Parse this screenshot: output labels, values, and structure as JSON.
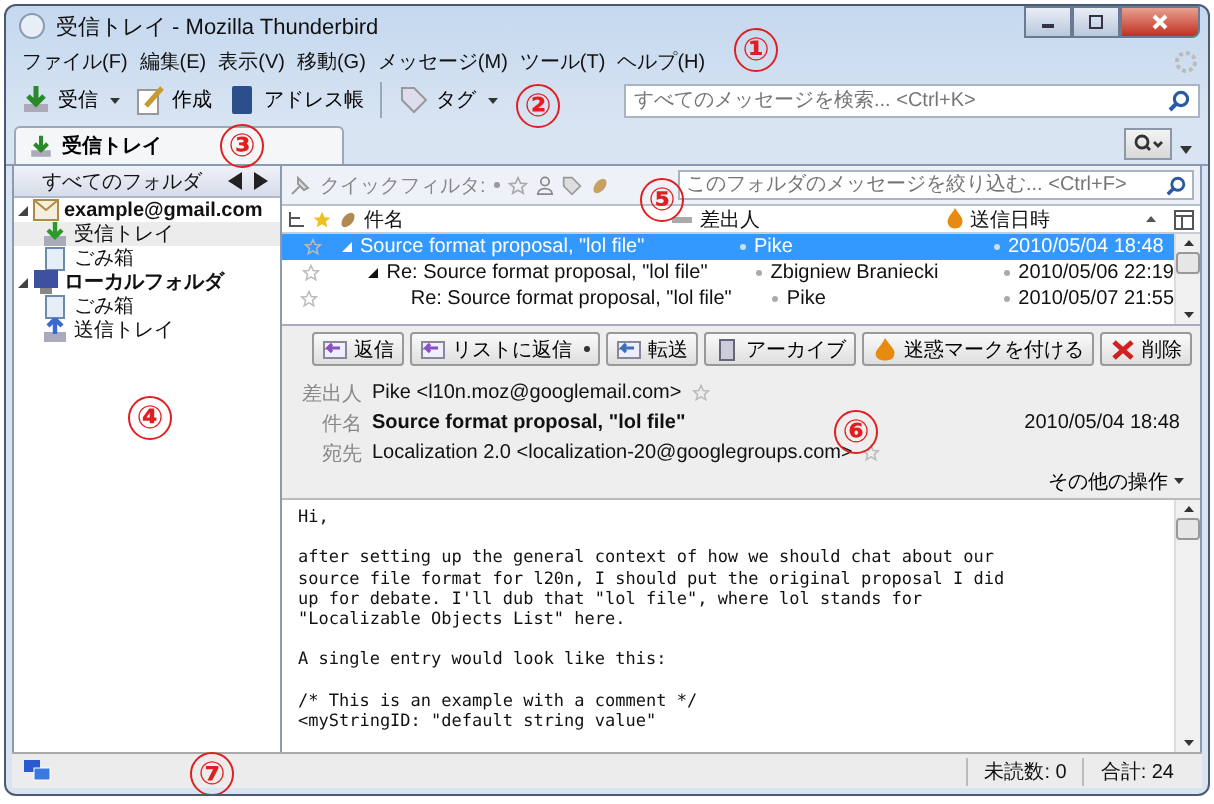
{
  "window": {
    "title": "受信トレイ - Mozilla Thunderbird"
  },
  "menu": [
    "ファイル(F)",
    "編集(E)",
    "表示(V)",
    "移動(G)",
    "メッセージ(M)",
    "ツール(T)",
    "ヘルプ(H)"
  ],
  "toolbar": {
    "buttons": [
      {
        "label": "受信",
        "kind": "get",
        "dropdown": true
      },
      {
        "label": "作成",
        "kind": "write",
        "dropdown": false
      },
      {
        "label": "アドレス帳",
        "kind": "book",
        "dropdown": false
      },
      {
        "label": "タグ",
        "kind": "tag",
        "dropdown": true
      }
    ],
    "search": {
      "placeholder": "すべてのメッセージを検索... <Ctrl+K>"
    }
  },
  "tabs": [
    {
      "label": "受信トレイ",
      "selected": true
    }
  ],
  "folder_pane": {
    "header": "すべてのフォルダ",
    "accounts": [
      {
        "name": "example@gmail.com",
        "kind": "mail",
        "expanded": true,
        "children": [
          {
            "name": "受信トレイ",
            "kind": "inbox",
            "selected": true
          },
          {
            "name": "ごみ箱",
            "kind": "trash",
            "selected": false
          }
        ]
      },
      {
        "name": "ローカルフォルダ",
        "kind": "local",
        "expanded": true,
        "children": [
          {
            "name": "ごみ箱",
            "kind": "trash",
            "selected": false
          },
          {
            "name": "送信トレイ",
            "kind": "outbox",
            "selected": false
          }
        ]
      }
    ]
  },
  "quick_filter": {
    "label": "クイックフィルタ:",
    "placeholder": "このフォルダのメッセージを絞り込む... <Ctrl+F>"
  },
  "thread_list": {
    "columns": [
      "件名",
      "差出人",
      "送信日時"
    ],
    "rows": [
      {
        "subject": "Source format proposal, \"lol file\"",
        "sender": "Pike",
        "date": "2010/05/04 18:48",
        "selected": true,
        "starred": false,
        "children": [
          {
            "subject": "Re: Source format proposal, \"lol file\"",
            "sender": "Zbigniew Braniecki",
            "date": "2010/05/06 22:19",
            "selected": false,
            "starred": false,
            "children": [
              {
                "subject": "Re: Source format proposal, \"lol file\"",
                "sender": "Pike",
                "date": "2010/05/07 21:55",
                "selected": false,
                "starred": false
              }
            ]
          }
        ]
      }
    ]
  },
  "message": {
    "actions": [
      {
        "label": "返信",
        "kind": "reply",
        "dropdown": false
      },
      {
        "label": "リストに返信",
        "kind": "reply-list",
        "dropdown": true
      },
      {
        "label": "転送",
        "kind": "forward",
        "dropdown": false
      },
      {
        "label": "アーカイブ",
        "kind": "archive",
        "dropdown": false
      },
      {
        "label": "迷惑マークを付ける",
        "kind": "junk",
        "dropdown": false
      },
      {
        "label": "削除",
        "kind": "delete",
        "dropdown": false
      }
    ],
    "from_label": "差出人",
    "from": "Pike <l10n.moz@googlemail.com>",
    "subject_label": "件名",
    "subject": "Source format proposal, \"lol file\"",
    "date": "2010/05/04 18:48",
    "to_label": "宛先",
    "to": "Localization 2.0 <localization-20@googlegroups.com>",
    "other_actions": "その他の操作",
    "body": [
      [
        "Hi,"
      ],
      [
        "after setting up the general context of how we should chat about our",
        "source file format for l20n, I should put the original proposal I did",
        "up for debate. I'll dub that \"lol file\", where lol stands for",
        "\"Localizable Objects List\" here."
      ],
      [
        "A single entry would look like this:"
      ],
      [
        "/* This is an example with a comment */",
        "<myStringID: \"default string value\""
      ]
    ]
  },
  "status_bar": {
    "unread": "未読数: 0",
    "total": "合計: 24"
  },
  "callouts": [
    "①",
    "②",
    "③",
    "④",
    "⑤",
    "⑥",
    "⑦"
  ]
}
